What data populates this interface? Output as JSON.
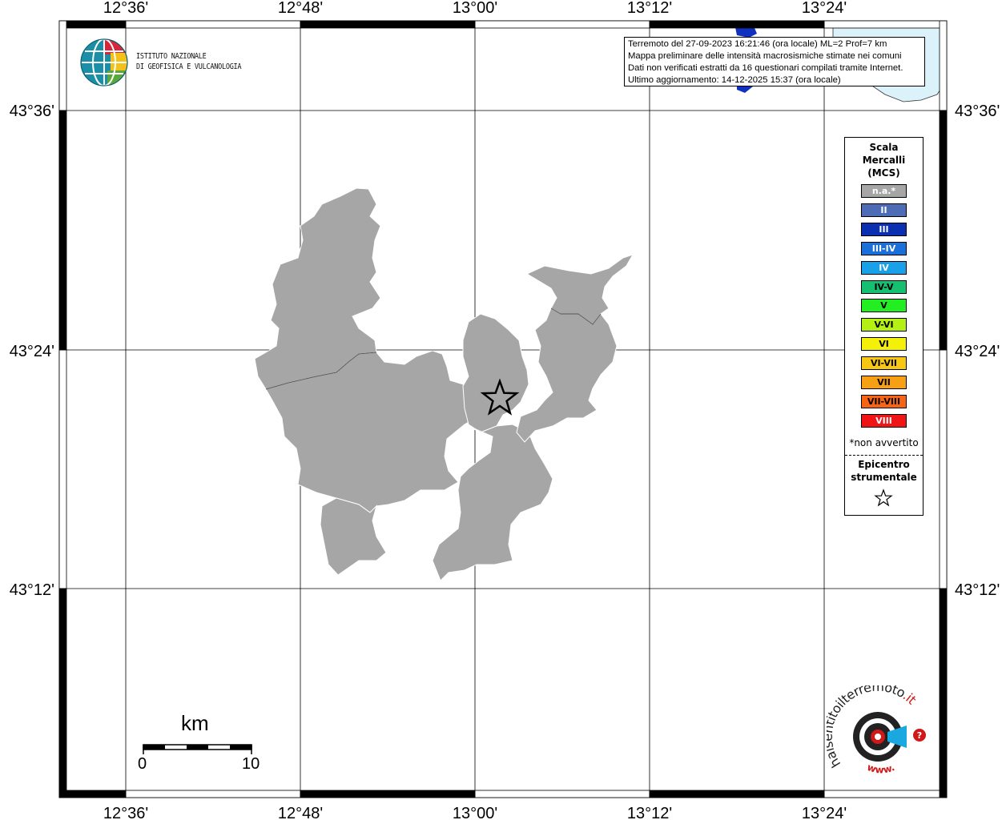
{
  "info": {
    "line1": "Terremoto del 27-09-2023 16:21:46 (ora locale) ML=2 Prof=7 km",
    "line2": "Mappa preliminare delle intensità macrosismiche stimate nei comuni",
    "line3": "Dati non verificati estratti da 16 questionari compilati tramite Internet.",
    "line4": "Ultimo aggiornamento: 14-12-2025 15:37 (ora locale)"
  },
  "institute": {
    "line1": "ISTITUTO NAZIONALE",
    "line2": "DI GEOFISICA E VULCANOLOGIA"
  },
  "grid": {
    "lon_labels": [
      "12°36'",
      "12°48'",
      "13°00'",
      "13°12'",
      "13°24'"
    ],
    "lat_labels": [
      "43°36'",
      "43°24'",
      "43°12'"
    ]
  },
  "legend": {
    "title_line1": "Scala",
    "title_line2": "Mercalli",
    "title_line3": "(MCS)",
    "items": [
      {
        "label": "n.a.*",
        "color": "#a6a6a6",
        "text_color": "#ffffff"
      },
      {
        "label": "II",
        "color": "#4e6bb5",
        "text_color": "#ffffff"
      },
      {
        "label": "III",
        "color": "#0a2fb0",
        "text_color": "#ffffff"
      },
      {
        "label": "III-IV",
        "color": "#1a6fd8",
        "text_color": "#ffffff"
      },
      {
        "label": "IV",
        "color": "#18a0e8",
        "text_color": "#ffffff"
      },
      {
        "label": "IV-V",
        "color": "#16c070",
        "text_color": "#000000"
      },
      {
        "label": "V",
        "color": "#22ee22",
        "text_color": "#000000"
      },
      {
        "label": "V-VI",
        "color": "#b4f014",
        "text_color": "#000000"
      },
      {
        "label": "VI",
        "color": "#f4f00a",
        "text_color": "#000000"
      },
      {
        "label": "VI-VII",
        "color": "#f6c814",
        "text_color": "#000000"
      },
      {
        "label": "VII",
        "color": "#f8a014",
        "text_color": "#000000"
      },
      {
        "label": "VII-VIII",
        "color": "#f86414",
        "text_color": "#000000"
      },
      {
        "label": "VIII",
        "color": "#f01414",
        "text_color": "#ffffff"
      }
    ],
    "note": "*non avvertito",
    "epicenter_line1": "Epicentro",
    "epicenter_line2": "strumentale"
  },
  "scale_bar": {
    "unit": "km",
    "min_label": "0",
    "max_label": "10"
  },
  "watermark": {
    "brand_main": "haisentitoilterremoto",
    "brand_tld": ".it",
    "prefix": "www."
  },
  "colors": {
    "municipality_fill": "#a6a6a6",
    "sea": "#dcf2fa",
    "lake": "#1030c0",
    "brand_red": "#d01818"
  }
}
